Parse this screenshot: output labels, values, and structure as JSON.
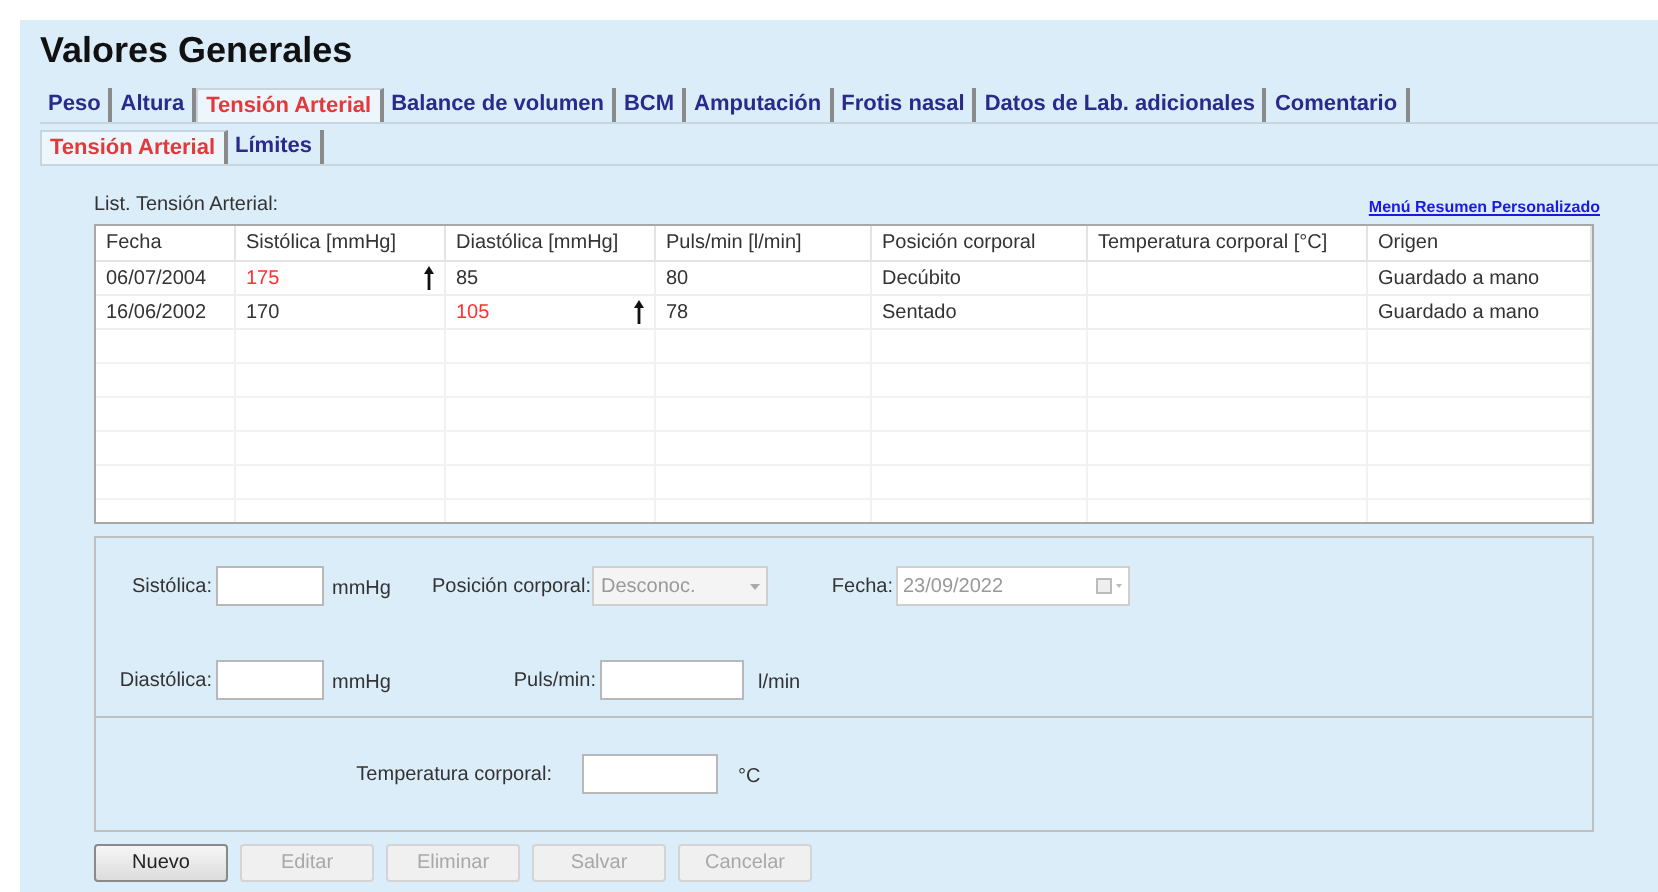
{
  "title": "Valores Generales",
  "tabs": [
    {
      "label": "Peso",
      "selected": false
    },
    {
      "label": "Altura",
      "selected": false
    },
    {
      "label": "Tensión Arterial",
      "selected": true
    },
    {
      "label": "Balance de volumen",
      "selected": false
    },
    {
      "label": "BCM",
      "selected": false
    },
    {
      "label": "Amputación",
      "selected": false
    },
    {
      "label": "Frotis nasal",
      "selected": false
    },
    {
      "label": "Datos de Lab. adicionales",
      "selected": false
    },
    {
      "label": "Comentario",
      "selected": false
    }
  ],
  "subtabs": [
    {
      "label": "Tensión Arterial",
      "selected": true
    },
    {
      "label": "Límites",
      "selected": false
    }
  ],
  "list_label": "List. Tensión Arterial:",
  "summary_link": "Menú Resumen Personalizado",
  "table": {
    "columns": [
      "Fecha",
      "Sistólica [mmHg]",
      "Diastólica [mmHg]",
      "Puls/min [l/min]",
      "Posición corporal",
      "Temperatura corporal [°C]",
      "Origen"
    ],
    "rows": [
      [
        {
          "text": "06/07/2004",
          "alert": false
        },
        {
          "text": "175",
          "alert": true
        },
        {
          "text": "85",
          "alert": false
        },
        {
          "text": "80",
          "alert": false
        },
        {
          "text": "Decúbito",
          "alert": false
        },
        null,
        {
          "text": "Guardado a mano",
          "alert": false
        }
      ],
      [
        {
          "text": "16/06/2002",
          "alert": false
        },
        {
          "text": "170",
          "alert": false
        },
        {
          "text": "105",
          "alert": true
        },
        {
          "text": "78",
          "alert": false
        },
        {
          "text": "Sentado",
          "alert": false
        },
        null,
        {
          "text": "Guardado a mano",
          "alert": false
        }
      ]
    ]
  },
  "form": {
    "systolic_label": "Sistólica:",
    "systolic_unit": "mmHg",
    "position_label": "Posición corporal:",
    "position_value": "Desconoc.",
    "date_label": "Fecha:",
    "date_value": "23/09/2022",
    "diastolic_label": "Diastólica:",
    "diastolic_unit": "mmHg",
    "pulse_label": "Puls/min:",
    "pulse_unit": "l/min",
    "temp_label": "Temperatura corporal:",
    "temp_unit": "°C"
  },
  "buttons": [
    {
      "label": "Nuevo",
      "disabled": false
    },
    {
      "label": "Editar",
      "disabled": true
    },
    {
      "label": "Eliminar",
      "disabled": true
    },
    {
      "label": "Salvar",
      "disabled": true
    },
    {
      "label": "Cancelar",
      "disabled": true
    }
  ]
}
